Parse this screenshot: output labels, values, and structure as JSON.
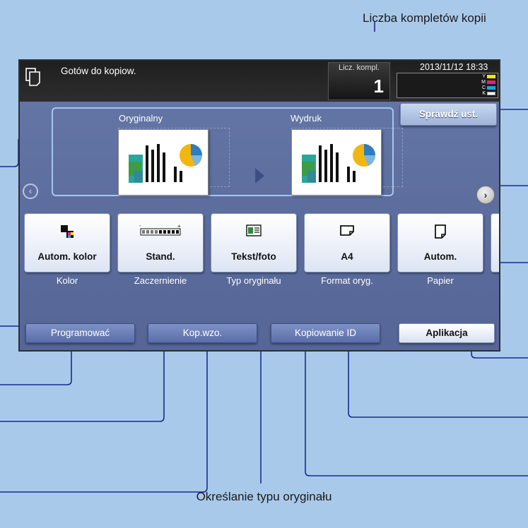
{
  "callouts": {
    "top": "Liczba kompletów kopii",
    "bottom": "Określanie typu oryginału"
  },
  "screen": {
    "status": "Gotów do kopiow.",
    "sets_label": "Licz. kompl.",
    "sets_value": "1",
    "datetime": "2013/11/12 18:33",
    "toner": [
      "Y",
      "M",
      "C",
      "K"
    ],
    "toner_colors": [
      "#f2e600",
      "#e0218a",
      "#18a6e0",
      "#ffffff"
    ],
    "check_button": "Sprawdź ust.",
    "original_label": "Oryginalny",
    "output_label": "Wydruk",
    "tiles": [
      {
        "label": "Autom. kolor",
        "caption": "Kolor",
        "icon": "color-icon"
      },
      {
        "label": "Stand.",
        "caption": "Zaczernienie",
        "icon": "density-icon"
      },
      {
        "label": "Tekst/foto",
        "caption": "Typ oryginału",
        "icon": "text-photo-icon"
      },
      {
        "label": "A4",
        "caption": "Format oryg.",
        "icon": "original-size-icon"
      },
      {
        "label": "Autom.",
        "caption": "Papier",
        "icon": "paper-icon"
      }
    ],
    "bottom_buttons": [
      "Programować",
      "Kop.wzo.",
      "Kopiowanie ID",
      "Aplikacja"
    ],
    "accent_color": "#5a6ea7"
  }
}
